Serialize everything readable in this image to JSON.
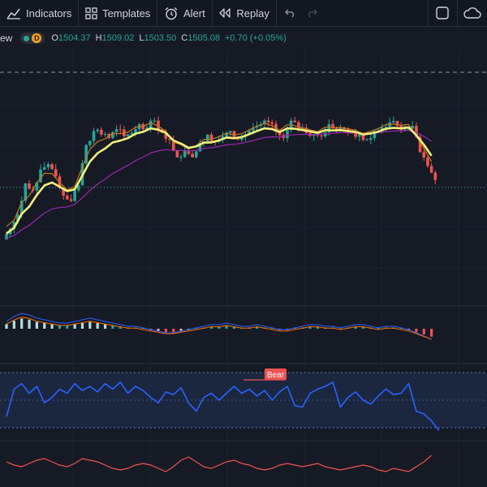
{
  "toolbar": {
    "indicators": "Indicators",
    "templates": "Templates",
    "alert": "Alert",
    "replay": "Replay"
  },
  "legend": {
    "symbol_tail": "ew",
    "badge": "D",
    "open_k": "O",
    "open_v": "1504.37",
    "high_k": "H",
    "high_v": "1509.02",
    "low_k": "L",
    "low_v": "1503.50",
    "close_k": "C",
    "close_v": "1505.08",
    "change": "+0.70 (+0.05%)"
  },
  "rsi": {
    "bear_label": "Bear"
  },
  "colors": {
    "background": "#161a25",
    "up": "#26a69a",
    "down": "#ef5350",
    "ma_fast": "#f4f07a",
    "ma_mid": "#c7771f",
    "ma_slow": "#9c27b0",
    "rsi": "#2962ff"
  },
  "chart_data": [
    {
      "type": "candlestick",
      "close": [
        1454,
        1462,
        1480,
        1476,
        1488,
        1491,
        1484,
        1473,
        1470,
        1479,
        1502,
        1510,
        1508,
        1506,
        1511,
        1507,
        1509,
        1514,
        1512,
        1516,
        1509,
        1505,
        1495,
        1499,
        1495,
        1503,
        1508,
        1504,
        1507,
        1510,
        1505,
        1508,
        1512,
        1514,
        1515,
        1510,
        1506,
        1516,
        1511,
        1509,
        1508,
        1507,
        1514,
        1510,
        1511,
        1509,
        1508,
        1505,
        1510,
        1512,
        1515,
        1513,
        1511,
        1513,
        1498,
        1490,
        1482
      ],
      "moving_averages": [
        {
          "values": "ma_fast"
        },
        {
          "values": "ma_mid"
        },
        {
          "values": "ma_slow"
        }
      ]
    },
    {
      "type": "macd",
      "histogram": [
        0.4,
        0.7,
        0.9,
        0.8,
        0.6,
        0.5,
        0.4,
        0.3,
        0.3,
        0.4,
        0.5,
        0.6,
        0.5,
        0.4,
        0.3,
        0.2,
        0.1,
        0.1,
        0.0,
        -0.1,
        -0.2,
        -0.3,
        -0.3,
        -0.2,
        -0.1,
        0.0,
        0.1,
        0.2,
        0.2,
        0.3,
        0.2,
        0.1,
        0.1,
        0.2,
        0.1,
        0.0,
        -0.1,
        -0.1,
        0.0,
        0.1,
        0.2,
        0.2,
        0.1,
        0.1,
        0.0,
        0.1,
        0.2,
        0.2,
        0.1,
        0.0,
        0.1,
        0.1,
        0.0,
        -0.1,
        -0.3,
        -0.5,
        -0.7
      ]
    },
    {
      "type": "line",
      "name": "RSI",
      "values": [
        38,
        58,
        62,
        55,
        60,
        48,
        52,
        58,
        55,
        62,
        57,
        60,
        56,
        62,
        58,
        63,
        55,
        60,
        57,
        52,
        48,
        56,
        54,
        59,
        48,
        42,
        52,
        55,
        50,
        55,
        60,
        55,
        58,
        53,
        57,
        50,
        56,
        60,
        46,
        45,
        55,
        58,
        60,
        63,
        45,
        52,
        56,
        50,
        47,
        53,
        58,
        54,
        55,
        62,
        42,
        40,
        35,
        28
      ]
    },
    {
      "type": "line",
      "name": "lower-oscillator",
      "values": [
        52,
        50,
        49,
        51,
        53,
        54,
        52,
        50,
        49,
        51,
        54,
        53,
        52,
        50,
        48,
        47,
        48,
        50,
        51,
        50,
        48,
        46,
        49,
        53,
        55,
        52,
        49,
        48,
        50,
        52,
        53,
        51,
        50,
        48,
        47,
        48,
        50,
        51,
        50,
        49,
        50,
        51,
        49,
        48,
        47,
        48,
        49,
        50,
        49,
        47,
        46,
        48,
        47,
        46,
        49,
        52,
        56
      ]
    }
  ]
}
